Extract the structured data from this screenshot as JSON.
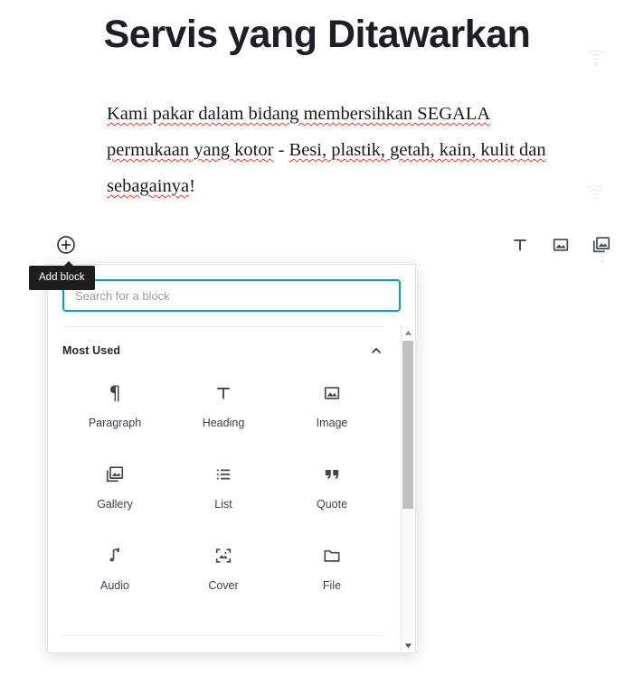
{
  "page": {
    "title": "Servis yang Ditawarkan",
    "paragraph_parts": [
      {
        "text": "Kami pakar dalam bidang membersihkan SEGALA permukaan yang kotor",
        "spellcheck": true
      },
      {
        "text": " - ",
        "spellcheck": false
      },
      {
        "text": "Besi, plastik, getah, kain, kulit dan sebagainya",
        "spellcheck": true
      },
      {
        "text": "!",
        "spellcheck": false
      }
    ],
    "paragraph_plain": "Kami pakar dalam bidang membersihkan SEGALA permukaan yang kotor - Besi, plastik, getah, kain, kulit dan sebagainya!"
  },
  "quick_toolbar": {
    "items": [
      {
        "icon": "heading-icon",
        "name": "quick-insert-heading"
      },
      {
        "icon": "image-icon",
        "name": "quick-insert-image"
      },
      {
        "icon": "gallery-icon",
        "name": "quick-insert-gallery"
      }
    ]
  },
  "add_block": {
    "icon": "plus-circle-icon",
    "tooltip": "Add block"
  },
  "inserter": {
    "search": {
      "value": "",
      "placeholder": "Search for a block"
    },
    "section": {
      "title": "Most Used",
      "collapse_icon": "chevron-up-icon",
      "expanded": true
    },
    "blocks": [
      {
        "label": "Paragraph",
        "icon": "paragraph-icon"
      },
      {
        "label": "Heading",
        "icon": "heading-icon"
      },
      {
        "label": "Image",
        "icon": "image-icon"
      },
      {
        "label": "Gallery",
        "icon": "gallery-icon"
      },
      {
        "label": "List",
        "icon": "list-icon"
      },
      {
        "label": "Quote",
        "icon": "quote-icon"
      },
      {
        "label": "Audio",
        "icon": "audio-icon"
      },
      {
        "label": "Cover",
        "icon": "cover-icon"
      },
      {
        "label": "File",
        "icon": "file-icon"
      }
    ],
    "scrollbar": {
      "up_icon": "scroll-up-arrow-icon",
      "down_icon": "scroll-down-arrow-icon"
    }
  },
  "watermarks": [
    {
      "icon": "wifi-off-icon"
    },
    {
      "icon": "wifi-off-icon"
    }
  ],
  "colors": {
    "accent": "#00a0d2",
    "tooltip_bg": "#1e1e1e",
    "heading_text": "#1c2024",
    "icon": "#40464d",
    "spellcheck_underline": "#e03c31",
    "scrollbar_thumb": "#c1c1c1"
  }
}
